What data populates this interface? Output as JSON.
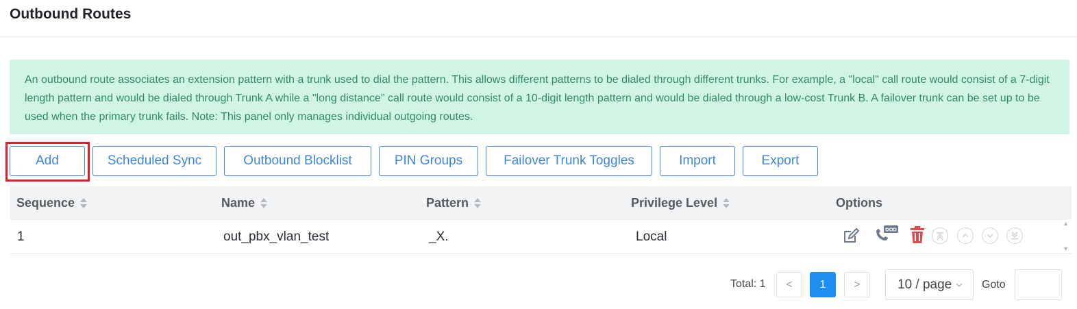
{
  "page": {
    "title": "Outbound Routes"
  },
  "notice": {
    "text": "An outbound route associates an extension pattern with a trunk used to dial the pattern. This allows different patterns to be dialed through different trunks. For example, a \"local\" call route would consist of a 7-digit length pattern and would be dialed through Trunk A while a \"long distance\" call route would consist of a 10-digit length pattern and would be dialed through a low-cost Trunk B. A failover trunk can be set up to be used when the primary trunk fails. Note: This panel only manages individual outgoing routes."
  },
  "toolbar": {
    "add": "Add",
    "scheduled_sync": "Scheduled Sync",
    "outbound_blocklist": "Outbound Blocklist",
    "pin_groups": "PIN Groups",
    "failover_trunk_toggles": "Failover Trunk Toggles",
    "import": "Import",
    "export": "Export"
  },
  "table": {
    "columns": [
      "Sequence",
      "Name",
      "Pattern",
      "Privilege Level",
      "Options"
    ],
    "rows": [
      {
        "sequence": "1",
        "name": "out_pbx_vlan_test",
        "pattern": "_X.",
        "privilege": "Local"
      }
    ],
    "options_icons": [
      "edit-icon",
      "dod-phone-icon",
      "delete-icon",
      "move-top-icon",
      "move-up-icon",
      "move-down-icon",
      "move-bottom-icon"
    ]
  },
  "pagination": {
    "total": "Total: 1",
    "prev": "<",
    "current_page": "1",
    "next": ">",
    "page_size": "10 / page",
    "goto_label": "Goto",
    "goto_value": ""
  },
  "colors": {
    "accent": "#3d86d8",
    "notice_bg": "#d1f5e4",
    "notice_text": "#2e8b62",
    "highlight": "#dc1e2d",
    "delete": "#e5484d"
  }
}
